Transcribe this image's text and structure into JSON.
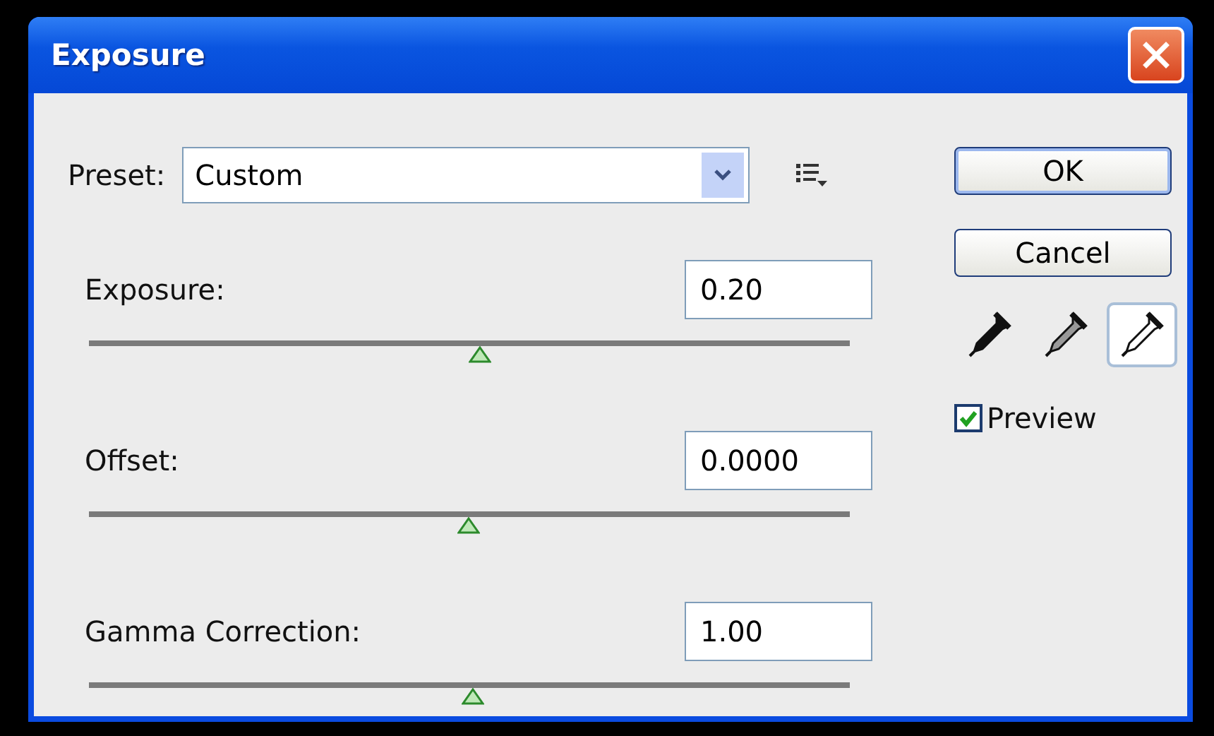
{
  "window": {
    "title": "Exposure"
  },
  "preset": {
    "label": "Preset:",
    "value": "Custom"
  },
  "sliders": [
    {
      "label": "Exposure:",
      "value": "0.20",
      "level": 0.514
    },
    {
      "label": "Offset:",
      "value": "0.0000",
      "level": 0.499
    },
    {
      "label": "Gamma Correction:",
      "value": "1.00",
      "level": 0.505
    }
  ],
  "buttons": [
    "OK",
    "Cancel"
  ],
  "eyedroppers": [
    {
      "kind": "black",
      "selected": false
    },
    {
      "kind": "gray",
      "selected": false
    },
    {
      "kind": "white",
      "selected": true
    }
  ],
  "preview": {
    "label": "Preview",
    "checked": true
  }
}
